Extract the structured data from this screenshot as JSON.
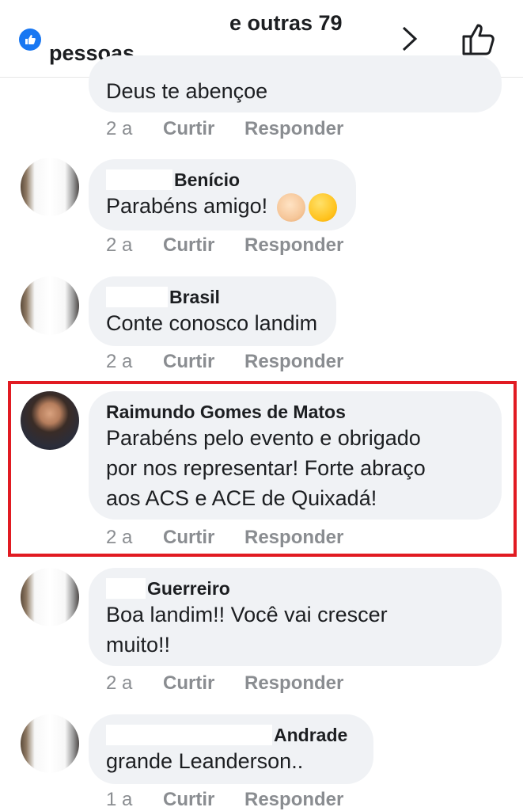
{
  "header": {
    "reactions_label": "e outras 79",
    "people_label": "pessoas",
    "colors": {
      "like_blue": "#1877f2"
    },
    "icons": [
      "like-reaction-icon",
      "chevron-right-icon",
      "thumbs-up-icon"
    ]
  },
  "comments": [
    {
      "name": "",
      "text": "Deus te abençoe",
      "time": "2 a",
      "like": "Curtir",
      "reply": "Responder"
    },
    {
      "name": "Benício",
      "text": "Parabéns amigo!",
      "time": "2 a",
      "like": "Curtir",
      "reply": "Responder",
      "emojis": [
        "clapping-hands-emoji",
        "kissing-wink-emoji"
      ]
    },
    {
      "name": "Brasil",
      "text": "Conte conosco landim",
      "time": "2 a",
      "like": "Curtir",
      "reply": "Responder"
    },
    {
      "name": "Raimundo Gomes de Matos",
      "text": "Parabéns pelo evento e obrigado",
      "text2": "por nos representar! Forte abraço",
      "text3": "aos ACS e ACE de Quixadá!",
      "time": "2 a",
      "like": "Curtir",
      "reply": "Responder",
      "highlighted": true,
      "highlight_color": "#e11b22"
    },
    {
      "name": "Guerreiro",
      "text": "Boa landim!! Você vai crescer",
      "text2": "muito!!",
      "time": "2 a",
      "like": "Curtir",
      "reply": "Responder"
    },
    {
      "name": "Andrade",
      "text": "grande Leanderson..",
      "time": "1 a",
      "like": "Curtir",
      "reply": "Responder"
    }
  ]
}
